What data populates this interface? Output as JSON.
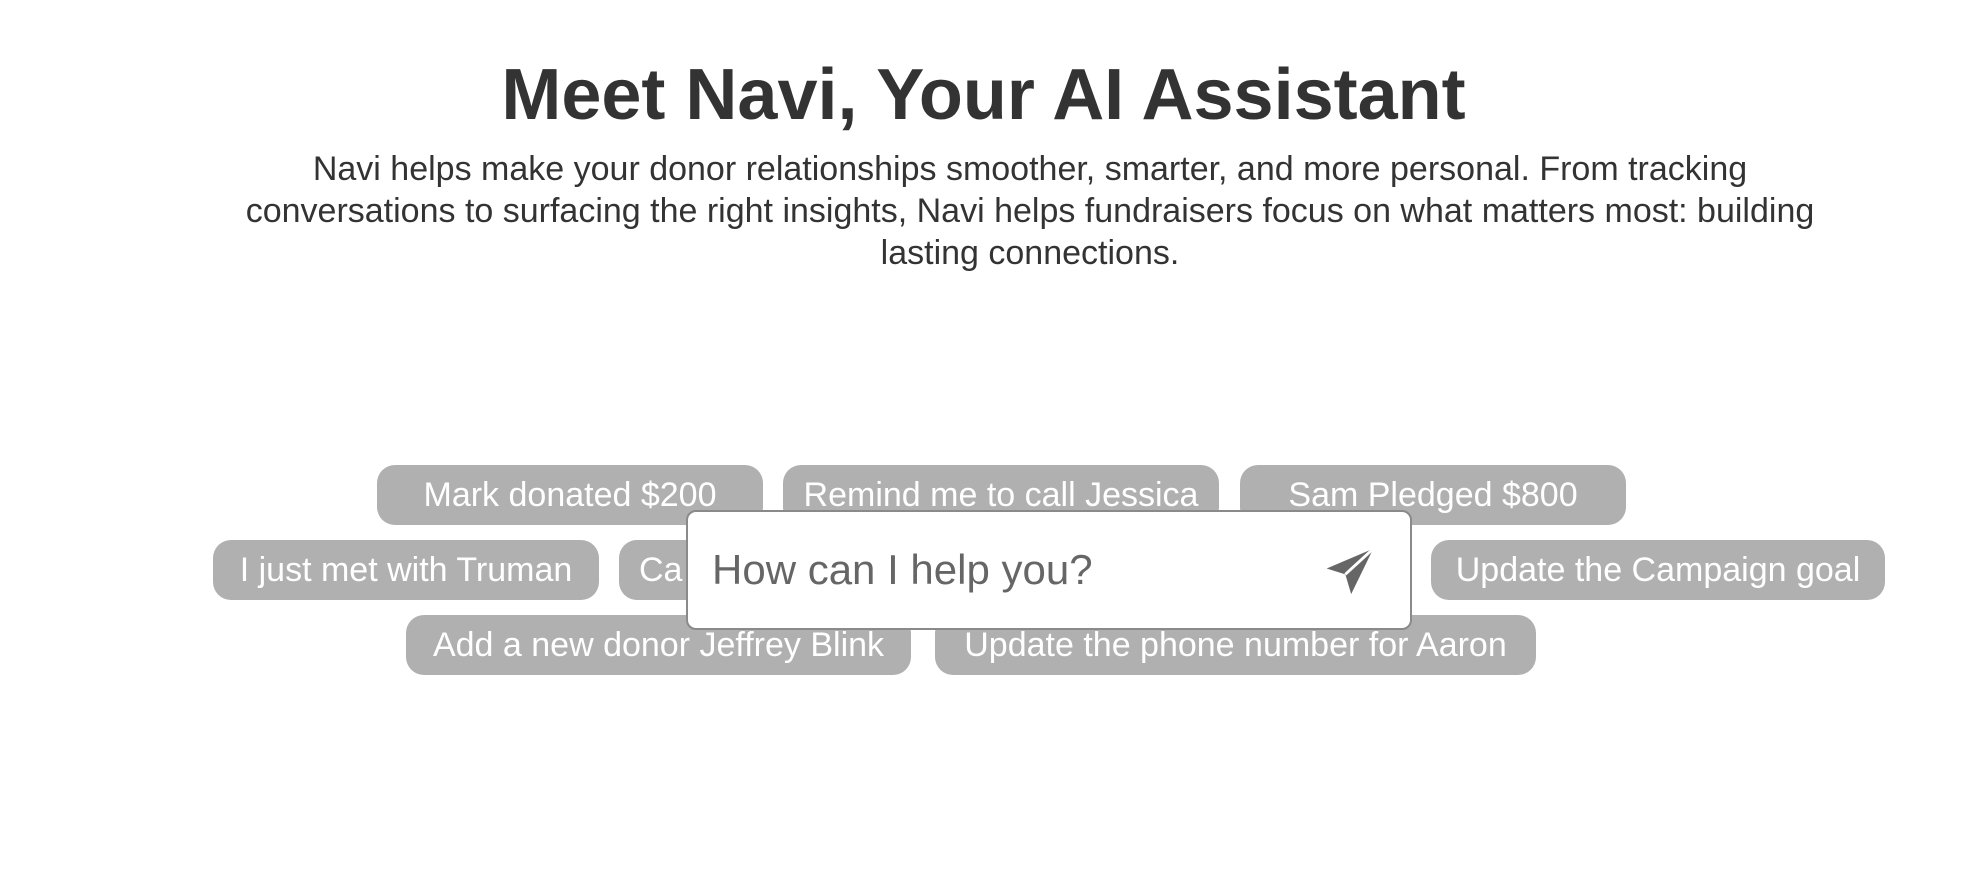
{
  "hero": {
    "title": "Meet Navi, Your AI Assistant",
    "description": "Navi helps make your donor relationships smoother, smarter, and more personal. From tracking conversations to surfacing the right insights, Navi helps fundraisers focus on what matters most: building lasting connections."
  },
  "suggestions": [
    {
      "label": "Mark donated $200"
    },
    {
      "label": "Remind me to call Jessica"
    },
    {
      "label": "Sam Pledged $800"
    },
    {
      "label": "I just met with Truman"
    },
    {
      "label": "Ca"
    },
    {
      "label": "Update the Campaign goal"
    },
    {
      "label": "Add a new donor Jeffrey Blink"
    },
    {
      "label": "Update the phone number for Aaron"
    }
  ],
  "chat": {
    "placeholder": "How can I help you?",
    "send_icon": "send-icon"
  },
  "colors": {
    "chip_background": "#b0b0b0",
    "chip_text": "#ffffff",
    "heading_text": "#333333",
    "input_border": "#8a8a8a",
    "send_icon": "#666666"
  }
}
